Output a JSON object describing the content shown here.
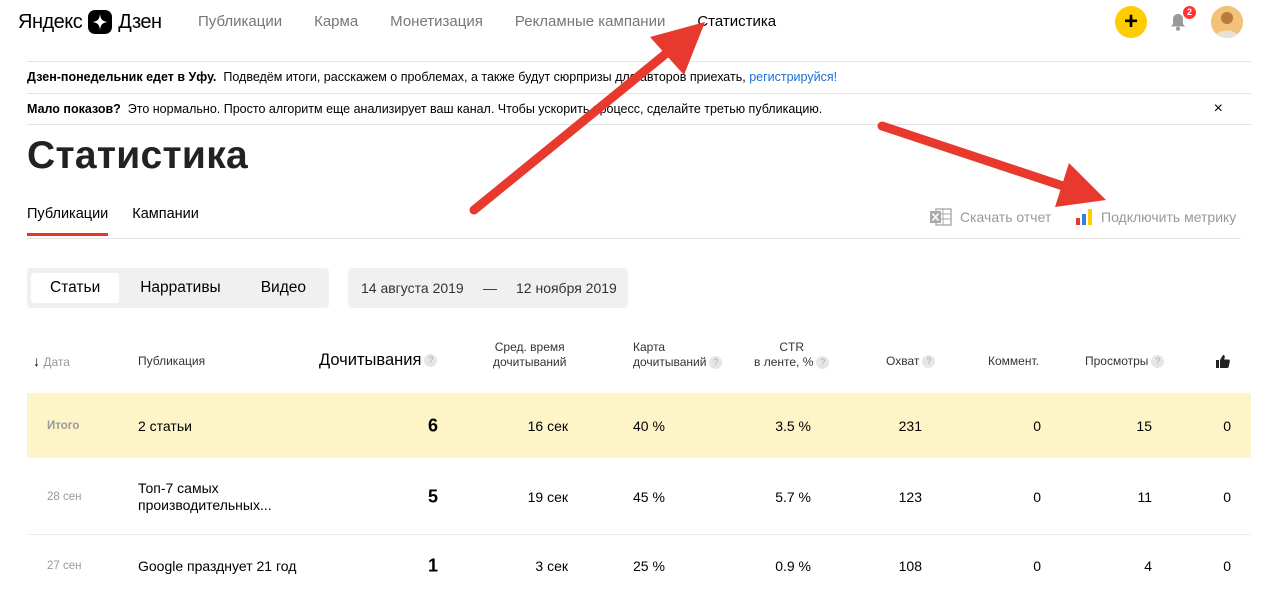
{
  "header": {
    "logo_left": "Яндекс",
    "logo_right": "Дзен",
    "nav": [
      "Публикации",
      "Карма",
      "Монетизация",
      "Рекламные кампании",
      "Статистика"
    ],
    "active_nav": "Статистика",
    "plus": "+",
    "notifications_count": "2"
  },
  "notices": {
    "n1_bold": "Дзен-понедельник едет в Уфу.",
    "n1_text": "Подведём итоги, расскажем о проблемах, а также будут сюрпризы для авторов приехать,",
    "n1_link": "регистрируйся!",
    "n2_bold": "Мало показов?",
    "n2_text": "Это нормально. Просто алгоритм еще анализирует ваш канал. Чтобы ускорить процесс, сделайте третью публикацию.",
    "n2_close": "×"
  },
  "page_title": "Статистика",
  "subtabs": [
    "Публикации",
    "Кампании"
  ],
  "actions": {
    "download": "Скачать отчет",
    "metrika": "Подключить метрику"
  },
  "filters": {
    "segments": [
      "Статьи",
      "Нарративы",
      "Видео"
    ],
    "active_segment": "Статьи",
    "date_from": "14 августа 2019",
    "date_sep": "—",
    "date_to": "12 ноября 2019"
  },
  "table": {
    "headers": {
      "date": "Дата",
      "publication": "Публикация",
      "readthroughs": "Дочитывания",
      "avg_time_1": "Сред. время",
      "avg_time_2": "дочитываний",
      "map_1": "Карта",
      "map_2": "дочитываний",
      "ctr_1": "CTR",
      "ctr_2": "в ленте, %",
      "reach": "Охват",
      "comments": "Коммент.",
      "views": "Просмотры"
    },
    "total": {
      "label": "Итого",
      "publication": "2 статьи",
      "readthroughs": "6",
      "avg_time": "16 сек",
      "map": "40 %",
      "ctr": "3.5 %",
      "reach": "231",
      "comments": "0",
      "views": "15",
      "likes": "0"
    },
    "rows": [
      {
        "date": "28 сен",
        "publication": "Топ-7 самых производительных...",
        "readthroughs": "5",
        "avg_time": "19 сек",
        "map": "45 %",
        "ctr": "5.7 %",
        "reach": "123",
        "comments": "0",
        "views": "11",
        "likes": "0"
      },
      {
        "date": "27 сен",
        "publication": "Google празднует 21 год",
        "readthroughs": "1",
        "avg_time": "3 сек",
        "map": "25 %",
        "ctr": "0.9 %",
        "reach": "108",
        "comments": "0",
        "views": "4",
        "likes": "0"
      }
    ]
  },
  "colors": {
    "accent_yellow": "#ffcc00",
    "active_tab_red": "#ee3322",
    "total_row_bg": "#fdf4c8",
    "annotation_arrow": "#e8392e",
    "link_blue": "#1a6fd8"
  }
}
